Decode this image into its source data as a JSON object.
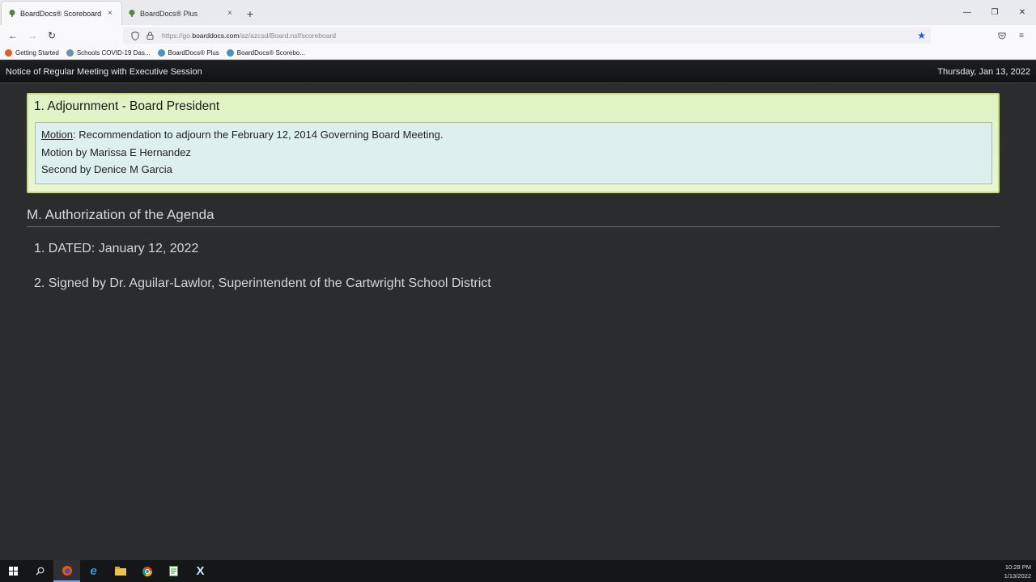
{
  "browser": {
    "tabs": [
      {
        "title": "BoardDocs® Scoreboard",
        "close": "×"
      },
      {
        "title": "BoardDocs® Plus",
        "close": "×"
      }
    ],
    "new_tab": "+",
    "window_controls": {
      "minimize": "—",
      "restore": "❐",
      "close": "✕"
    },
    "url_prefix": "https://go.",
    "url_domain": "boarddocs.com",
    "url_path": "/az/azcsd/Board.nsf/scoreboard",
    "bookmarks": [
      {
        "label": "Getting Started",
        "icon": "firefox-icon",
        "color": "#e25b2c"
      },
      {
        "label": "Schools COVID-19 Das...",
        "icon": "globe-icon",
        "color": "#6b8fb3"
      },
      {
        "label": "BoardDocs® Plus",
        "icon": "boarddocs-icon",
        "color": "#4a8fc7"
      },
      {
        "label": "BoardDocs® Scorebo...",
        "icon": "boarddocs-icon",
        "color": "#4a8fc7"
      }
    ]
  },
  "header": {
    "title": "Notice of Regular Meeting with Executive Session",
    "date": "Thursday, Jan 13, 2022"
  },
  "agenda_item": {
    "title": "1. Adjournment - Board President",
    "motion_label": "Motion",
    "motion_text": ": Recommendation to adjourn the February 12, 2014 Governing Board Meeting.",
    "motion_by": "Motion by Marissa E Hernandez",
    "second_by": "Second by Denice M Garcia"
  },
  "section": {
    "title": "M. Authorization of the Agenda",
    "items": [
      "1. DATED: January 12, 2022",
      "2. Signed by Dr. Aguilar-Lawlor, Superintendent of the Cartwright School District"
    ]
  },
  "taskbar": {
    "time": "10:28 PM",
    "date": "1/13/2022"
  },
  "colors": {
    "accent_green_box": "#dff3c4",
    "motion_box": "#def0ee",
    "page_bg": "#2b2c2d"
  }
}
